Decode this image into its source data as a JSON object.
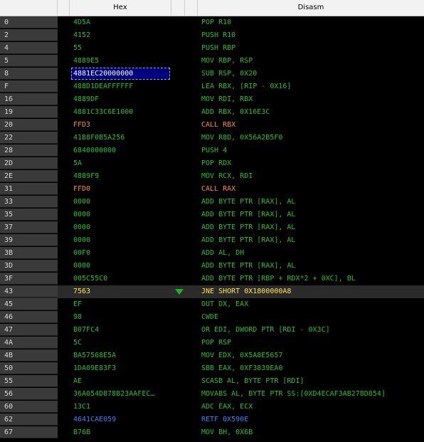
{
  "columns": {
    "hex": "Hex",
    "disasm": "Disasm"
  },
  "colors": {
    "normal": "#22c122",
    "call": "#ff8c1a",
    "ret": "#3f7dff",
    "jump": "#ffe54d",
    "selection": "#000080"
  },
  "rows": [
    {
      "addr": "0",
      "hex": "4D5A",
      "disasm": "POP R10",
      "kind": "normal"
    },
    {
      "addr": "2",
      "hex": "4152",
      "disasm": "PUSH R10",
      "kind": "normal"
    },
    {
      "addr": "4",
      "hex": "55",
      "disasm": "PUSH RBP",
      "kind": "normal"
    },
    {
      "addr": "5",
      "hex": "4889E5",
      "disasm": "MOV RBP, RSP",
      "kind": "normal"
    },
    {
      "addr": "8",
      "hex": "4881EC20000000",
      "disasm": "SUB RSP, 0X20",
      "kind": "normal",
      "selected": true
    },
    {
      "addr": "F",
      "hex": "488D1DEAFFFFFF",
      "disasm": "LEA RBX, [RIP - 0X16]",
      "kind": "normal"
    },
    {
      "addr": "16",
      "hex": "4889DF",
      "disasm": "MOV RDI, RBX",
      "kind": "normal"
    },
    {
      "addr": "19",
      "hex": "4881C33C6E1000",
      "disasm": "ADD RBX, 0X16E3C",
      "kind": "normal"
    },
    {
      "addr": "20",
      "hex": "FFD3",
      "disasm": "CALL RBX",
      "kind": "call"
    },
    {
      "addr": "22",
      "hex": "41B8F0B5A256",
      "disasm": "MOV R8D, 0X56A2B5F0",
      "kind": "normal"
    },
    {
      "addr": "28",
      "hex": "6840000000",
      "disasm": "PUSH 4",
      "kind": "normal"
    },
    {
      "addr": "2D",
      "hex": "5A",
      "disasm": "POP RDX",
      "kind": "normal"
    },
    {
      "addr": "2E",
      "hex": "4889F9",
      "disasm": "MOV RCX, RDI",
      "kind": "normal"
    },
    {
      "addr": "31",
      "hex": "FFD0",
      "disasm": "CALL RAX",
      "kind": "call"
    },
    {
      "addr": "33",
      "hex": "0000",
      "disasm": "ADD BYTE PTR [RAX], AL",
      "kind": "normal"
    },
    {
      "addr": "35",
      "hex": "0000",
      "disasm": "ADD BYTE PTR [RAX], AL",
      "kind": "normal"
    },
    {
      "addr": "37",
      "hex": "0000",
      "disasm": "ADD BYTE PTR [RAX], AL",
      "kind": "normal"
    },
    {
      "addr": "39",
      "hex": "0000",
      "disasm": "ADD BYTE PTR [RAX], AL",
      "kind": "normal"
    },
    {
      "addr": "3B",
      "hex": "00F0",
      "disasm": "ADD AL, DH",
      "kind": "normal"
    },
    {
      "addr": "3D",
      "hex": "0000",
      "disasm": "ADD BYTE PTR [RAX], AL",
      "kind": "normal"
    },
    {
      "addr": "3F",
      "hex": "005C55C0",
      "disasm": "ADD BYTE PTR [RBP + RDX*2 + 0XC], BL",
      "kind": "normal"
    },
    {
      "addr": "43",
      "hex": "7563",
      "disasm": "JNE SHORT 0X1800000A8",
      "kind": "jump",
      "arrow": true
    },
    {
      "addr": "45",
      "hex": "EF",
      "disasm": "OUT DX, EAX",
      "kind": "normal"
    },
    {
      "addr": "46",
      "hex": "98",
      "disasm": "CWDE",
      "kind": "normal"
    },
    {
      "addr": "47",
      "hex": "B07FC4",
      "disasm": "OR EDI, DWORD PTR [RDI - 0X3C]",
      "kind": "normal"
    },
    {
      "addr": "4A",
      "hex": "5C",
      "disasm": "POP RSP",
      "kind": "normal"
    },
    {
      "addr": "4B",
      "hex": "BA57568E5A",
      "disasm": "MOV EDX, 0X5A8E5657",
      "kind": "normal"
    },
    {
      "addr": "50",
      "hex": "1DA09E83F3",
      "disasm": "SBB EAX, 0XF3839EA0",
      "kind": "normal"
    },
    {
      "addr": "55",
      "hex": "AE",
      "disasm": "SCASB AL, BYTE PTR [RDI]",
      "kind": "normal"
    },
    {
      "addr": "56",
      "hex": "36A054D878B23AAFEC…",
      "disasm": "MOVABS AL, BYTE PTR SS:[0XD4ECAF3AB278D854]",
      "kind": "normal"
    },
    {
      "addr": "60",
      "hex": "13C1",
      "disasm": "ADC EAX, ECX",
      "kind": "normal"
    },
    {
      "addr": "62",
      "hex": "4641CAE059",
      "disasm": "RETF 0X590E",
      "kind": "ret"
    },
    {
      "addr": "67",
      "hex": "B76B",
      "disasm": "MOV BH, 0X6B",
      "kind": "normal"
    }
  ]
}
